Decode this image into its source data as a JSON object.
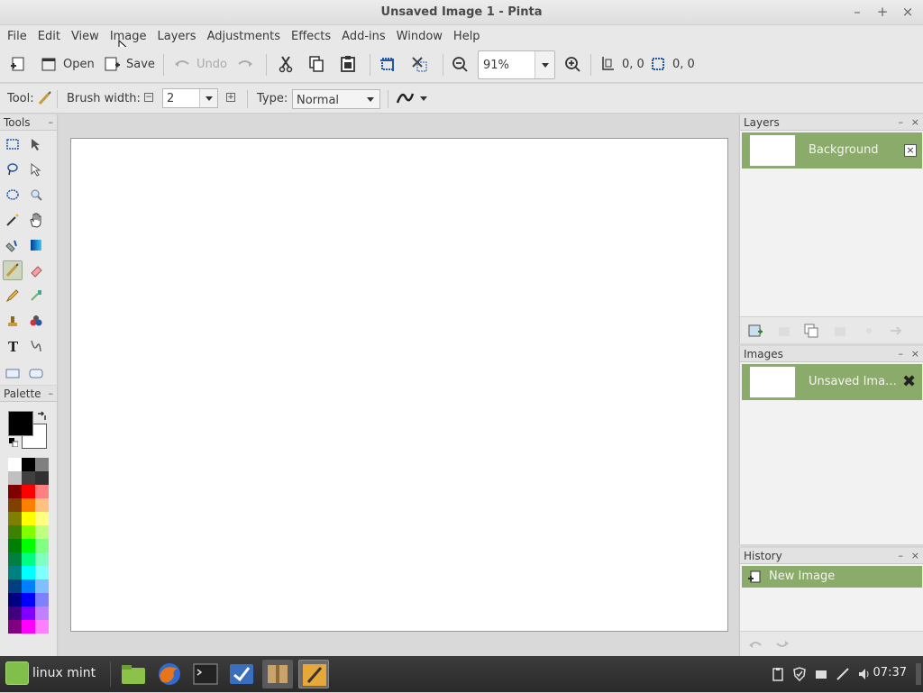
{
  "window": {
    "title": "Unsaved Image 1 - Pinta",
    "controls": [
      "–",
      "+",
      "×"
    ]
  },
  "menubar": [
    "File",
    "Edit",
    "View",
    "Image",
    "Layers",
    "Adjustments",
    "Effects",
    "Add-ins",
    "Window",
    "Help"
  ],
  "toolbar": {
    "open": "Open",
    "save": "Save",
    "undo": "Undo",
    "zoom": "91%",
    "cursor_pos": "0, 0",
    "selection_size": "0, 0"
  },
  "tool_options": {
    "tool_label": "Tool:",
    "brush_width_label": "Brush width:",
    "brush_width": "2",
    "type_label": "Type:",
    "type_value": "Normal"
  },
  "panels": {
    "tools": "Tools",
    "palette": "Palette",
    "layers": "Layers",
    "images": "Images",
    "history": "History"
  },
  "layers": [
    {
      "name": "Background"
    }
  ],
  "images": [
    {
      "name": "Unsaved Ima…"
    }
  ],
  "history": [
    {
      "name": "New Image"
    }
  ],
  "palette_colors": [
    [
      "#ffffff",
      "#000000",
      "#808080"
    ],
    [
      "#c0c0c0",
      "#404040",
      "#303030"
    ],
    [
      "#800000",
      "#ff0000",
      "#ff8080"
    ],
    [
      "#804000",
      "#ff8000",
      "#ffc080"
    ],
    [
      "#808000",
      "#ffff00",
      "#ffff80"
    ],
    [
      "#408000",
      "#80ff00",
      "#c0ff80"
    ],
    [
      "#008000",
      "#00ff00",
      "#80ff80"
    ],
    [
      "#008040",
      "#00ff80",
      "#80ffc0"
    ],
    [
      "#008080",
      "#00ffff",
      "#80ffff"
    ],
    [
      "#004080",
      "#0080ff",
      "#80c0ff"
    ],
    [
      "#000080",
      "#0000ff",
      "#8080ff"
    ],
    [
      "#400080",
      "#8000ff",
      "#c080ff"
    ],
    [
      "#800080",
      "#ff00ff",
      "#ff80ff"
    ]
  ],
  "taskbar": {
    "start_label": "linux mint",
    "clock": "07:37"
  }
}
